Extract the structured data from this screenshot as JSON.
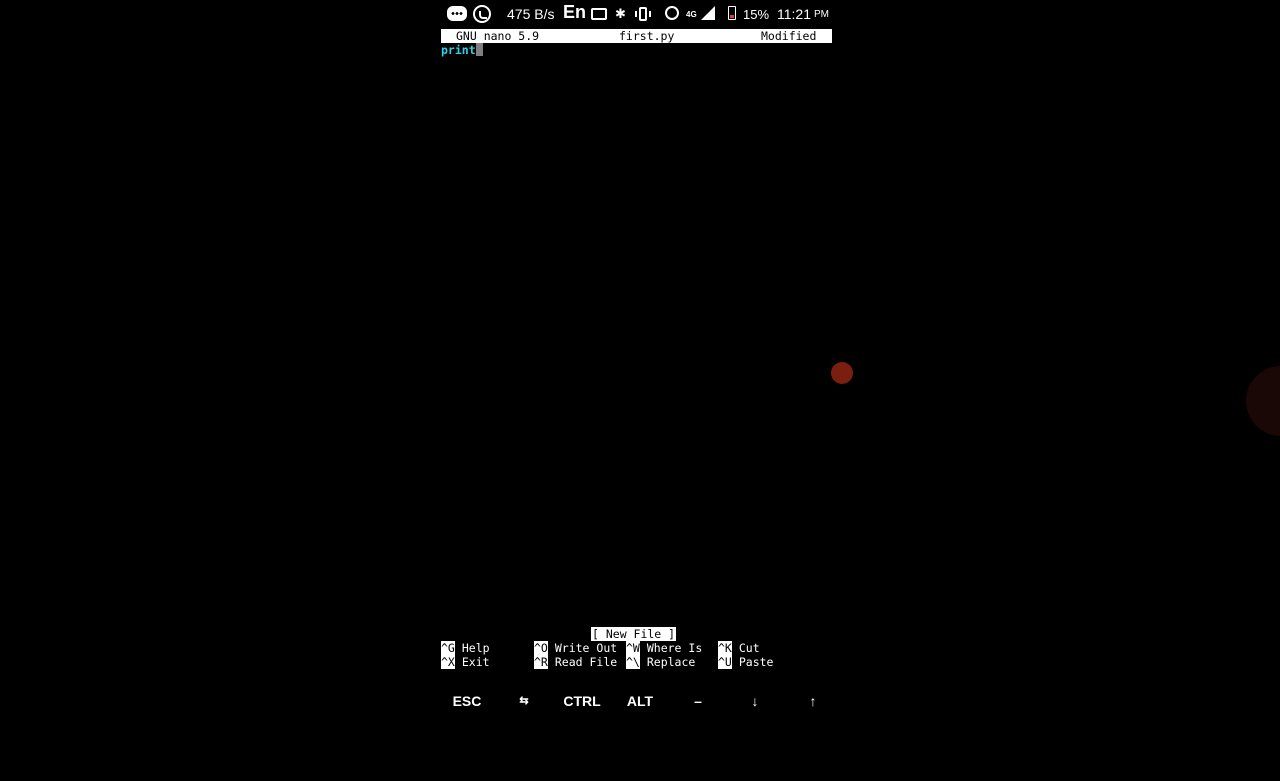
{
  "status_bar": {
    "net_speed": "475 B/s",
    "input_lang": "En",
    "network_type": "4G",
    "battery": "15%",
    "time": "11:21",
    "ampm": "PM",
    "icons": [
      "chat-icon",
      "whatsapp-icon",
      "cast-icon",
      "bluetooth-icon",
      "vibrate-icon",
      "alarm-icon",
      "signal-icon",
      "battery-icon"
    ]
  },
  "nano": {
    "version": "GNU nano 5.9",
    "filename": "first.py",
    "state": "Modified",
    "content": "print",
    "message": "[ New File ]",
    "shortcuts": [
      {
        "key": "^G",
        "label": "Help"
      },
      {
        "key": "^O",
        "label": "Write Out"
      },
      {
        "key": "^W",
        "label": "Where Is"
      },
      {
        "key": "^K",
        "label": "Cut"
      },
      {
        "key": "^X",
        "label": "Exit"
      },
      {
        "key": "^R",
        "label": "Read File"
      },
      {
        "key": "^\\",
        "label": "Replace"
      },
      {
        "key": "^U",
        "label": "Paste"
      }
    ]
  },
  "extra_keys": [
    "ESC",
    "⇆",
    "CTRL",
    "ALT",
    "–",
    "↓",
    "↑"
  ]
}
